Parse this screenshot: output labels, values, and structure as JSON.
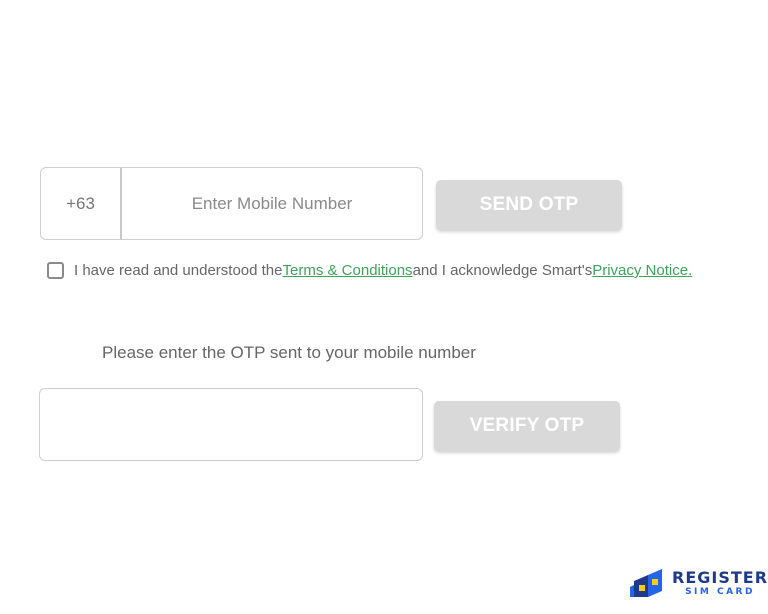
{
  "phone": {
    "country_code": "+63",
    "placeholder": "Enter Mobile Number",
    "value": ""
  },
  "send_otp": {
    "label": "SEND OTP"
  },
  "consent": {
    "checked": false,
    "text_before": "I have read and understood the ",
    "terms_link": "Terms & Conditions",
    "text_middle": " and I acknowledge Smart's ",
    "privacy_link": "Privacy Notice."
  },
  "otp": {
    "instruction": "Please enter the OTP sent to your mobile number",
    "value": "",
    "verify_label": "VERIFY OTP"
  },
  "logo": {
    "main": "REGISTER",
    "sub": "SIM CARD"
  },
  "colors": {
    "button_disabled": "#d9d9d9",
    "link_green": "#3da35a",
    "logo_navy": "#1e3a8a",
    "logo_blue": "#2563eb",
    "logo_yellow": "#facc15"
  },
  "icons": {
    "logo_mark": "sim-card-icon"
  }
}
